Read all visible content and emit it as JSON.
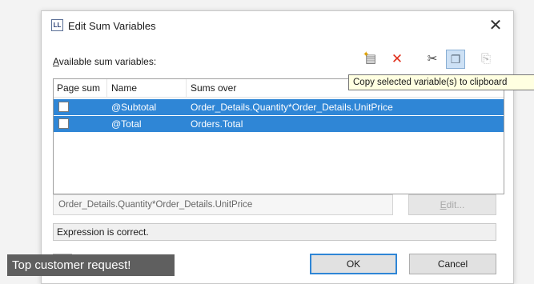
{
  "window": {
    "title": "Edit Sum Variables",
    "app_icon_text": "LL",
    "close_glyph": "✕"
  },
  "toolbar": {
    "available_label_accel": "A",
    "available_label_rest": "vailable sum variables:",
    "icons": [
      "new-variable-icon",
      "delete-icon",
      "cut-icon",
      "copy-icon",
      "paste-icon"
    ],
    "tooltip": "Copy selected variable(s) to clipboard"
  },
  "table": {
    "columns": [
      "Page sum",
      "Name",
      "Sums over"
    ],
    "rows": [
      {
        "page_sum": false,
        "name": "@Subtotal",
        "sums_over": "Order_Details.Quantity*Order_Details.UnitPrice",
        "selected": true
      },
      {
        "page_sum": false,
        "name": "@Total",
        "sums_over": "Orders.Total",
        "selected": true
      }
    ]
  },
  "expression": {
    "value": "Order_Details.Quantity*Order_Details.UnitPrice",
    "edit_accel": "E",
    "edit_rest": "dit..."
  },
  "status": "Expression is correct.",
  "buttons": {
    "ok": "OK",
    "cancel": "Cancel"
  },
  "banner": "Top customer request!",
  "colors": {
    "selection": "#2f86d6",
    "delete": "#e02f1c",
    "tooltip_bg": "#ffffe1",
    "banner_bg": "#5f5f5f"
  }
}
